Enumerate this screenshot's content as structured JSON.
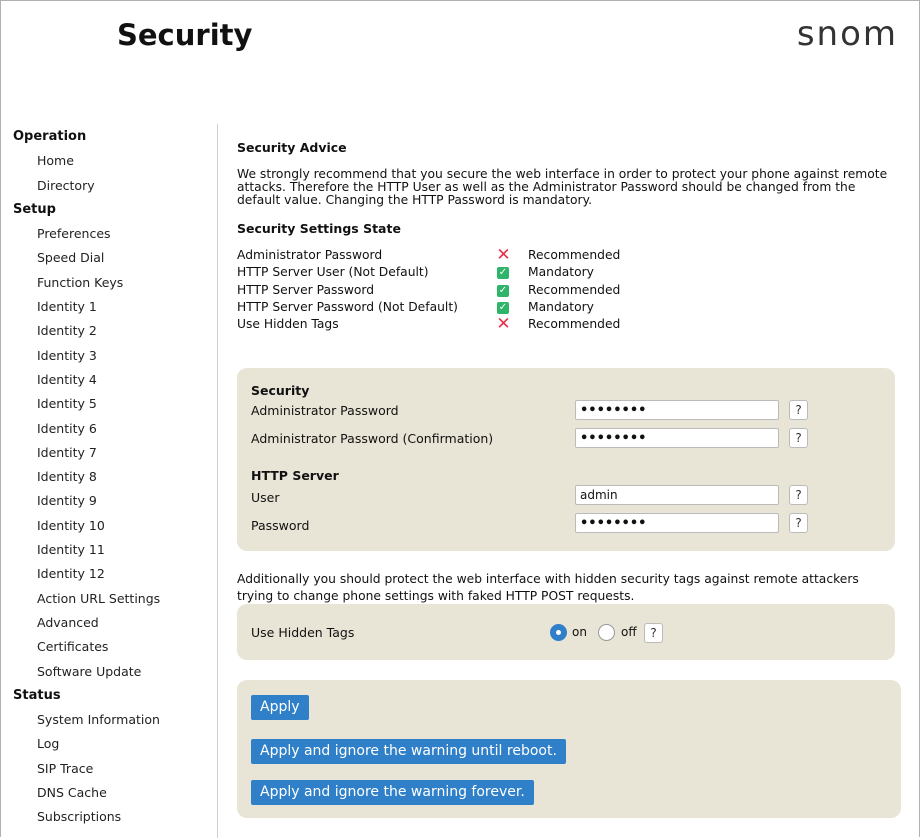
{
  "header": {
    "title": "Security",
    "logo": "snom"
  },
  "sidebar": {
    "groups": [
      {
        "label": "Operation",
        "items": [
          "Home",
          "Directory"
        ]
      },
      {
        "label": "Setup",
        "items": [
          "Preferences",
          "Speed Dial",
          "Function Keys",
          "Identity 1",
          "Identity 2",
          "Identity 3",
          "Identity 4",
          "Identity 5",
          "Identity 6",
          "Identity 7",
          "Identity 8",
          "Identity 9",
          "Identity 10",
          "Identity 11",
          "Identity 12",
          "Action URL Settings",
          "Advanced",
          "Certificates",
          "Software Update"
        ]
      },
      {
        "label": "Status",
        "items": [
          "System Information",
          "Log",
          "SIP Trace",
          "DNS Cache",
          "Subscriptions"
        ]
      }
    ]
  },
  "advice": {
    "heading": "Security Advice",
    "text": "We strongly recommend that you secure the web interface in order to protect your phone against remote attacks. Therefore the HTTP User as well as the Administrator Password should be changed from the default value. Changing the HTTP Password is mandatory."
  },
  "state": {
    "heading": "Security Settings State",
    "rows": [
      {
        "label": "Administrator Password",
        "icon": "cross-icon",
        "status": "Recommended"
      },
      {
        "label": "HTTP Server User (Not Default)",
        "icon": "check-icon",
        "status": "Mandatory"
      },
      {
        "label": "HTTP Server Password",
        "icon": "check-icon",
        "status": "Recommended"
      },
      {
        "label": "HTTP Server Password (Not Default)",
        "icon": "check-icon",
        "status": "Mandatory"
      },
      {
        "label": "Use Hidden Tags",
        "icon": "cross-icon",
        "status": "Recommended"
      }
    ]
  },
  "security_panel": {
    "heading": "Security",
    "admin_password_label": "Administrator Password",
    "admin_password_value": "••••••••",
    "admin_password_confirm_label": "Administrator Password (Confirmation)",
    "admin_password_confirm_value": "••••••••",
    "http_heading": "HTTP Server",
    "user_label": "User",
    "user_value": "admin",
    "password_label": "Password",
    "password_value": "••••••••",
    "help": "?"
  },
  "hidden_tags": {
    "text": "Additionally you should protect the web interface with hidden security tags against remote attackers trying to change phone settings with faked HTTP POST requests.",
    "label": "Use Hidden Tags",
    "on_label": "on",
    "off_label": "off",
    "selected": "on"
  },
  "buttons": {
    "apply": "Apply",
    "apply_reboot": "Apply and ignore the warning until reboot.",
    "apply_forever": "Apply and ignore the warning forever."
  },
  "colors": {
    "accent": "#2f80c8",
    "panel": "#e8e4d6",
    "error": "#e8304a",
    "success": "#2fb56a"
  }
}
